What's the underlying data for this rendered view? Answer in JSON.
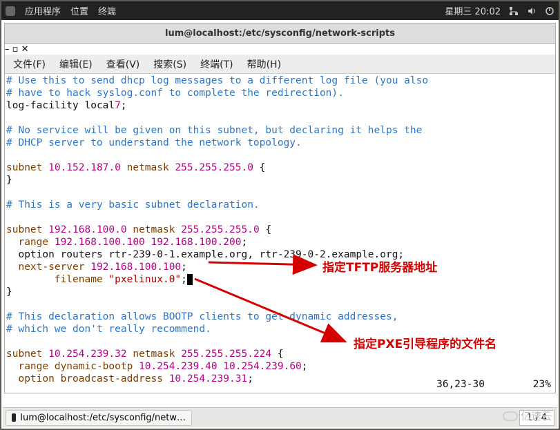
{
  "panel": {
    "apps": "应用程序",
    "places": "位置",
    "terminal": "终端",
    "clock": "星期三 20:02"
  },
  "window": {
    "title": "lum@localhost:/etc/sysconfig/network-scripts"
  },
  "menubar": {
    "file": "文件(F)",
    "edit": "编辑(E)",
    "view": "查看(V)",
    "search": "搜索(S)",
    "terminal": "终端(T)",
    "help": "帮助(H)"
  },
  "editor": {
    "c1": "# Use this to send dhcp log messages to a different log file (you also",
    "c2": "# have to hack syslog.conf to complete the redirection).",
    "l_logfac_a": "log-facility local",
    "l_logfac_b": "7",
    "c3": "# No service will be given on this subnet, but declaring it helps the",
    "c4": "# DHCP server to understand the network topology.",
    "sub1_a": "subnet ",
    "sub1_b": "10.152.187.0",
    "sub1_c": " netmask ",
    "sub1_d": "255.255.255.0",
    "sub1_e": " {",
    "brace1": "}",
    "c5": "# This is a very basic subnet declaration.",
    "sub2_a": "subnet ",
    "sub2_b": "192.168.100.0",
    "sub2_c": " netmask ",
    "sub2_d": "255.255.255.0",
    "sub2_e": " {",
    "range_a": "  range ",
    "range_b": "192.168.100.100",
    "range_c": " ",
    "range_d": "192.168.100.200",
    "range_e": ";",
    "routers": "  option routers rtr-239-0-1.example.org, rtr-239-0-2.example.org;",
    "next_a": "  next-server ",
    "next_b": "192.168.100.100",
    "next_c": ";",
    "file_a": "        filename ",
    "file_b": "\"pxelinux.0\"",
    "file_c": ";",
    "brace2": "}",
    "c6": "# This declaration allows BOOTP clients to get dynamic addresses,",
    "c7": "# which we don't really recommend.",
    "sub3_a": "subnet ",
    "sub3_b": "10.254.239.32",
    "sub3_c": " netmask ",
    "sub3_d": "255.255.255.224",
    "sub3_e": " {",
    "dyn_a": "  range dynamic-bootp ",
    "dyn_b": "10.254.239.40",
    "dyn_c": " ",
    "dyn_d": "10.254.239.60",
    "dyn_e": ";",
    "bcast_a": "  option broadcast-address ",
    "bcast_b": "10.254.239.31",
    "bcast_c": ";",
    "status_pos": "36,23-30",
    "status_pct": "23%"
  },
  "annotations": {
    "tftp": "指定TFTP服务器地址",
    "pxe": "指定PXE引导程序的文件名"
  },
  "taskbar": {
    "item": "lum@localhost:/etc/sysconfig/netw…",
    "workspace": "1 / 4"
  },
  "watermark": "亿速云"
}
